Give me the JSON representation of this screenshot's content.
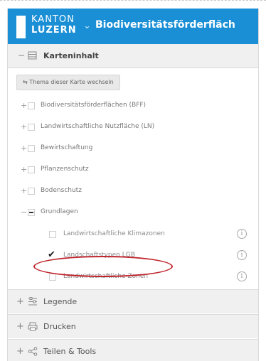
{
  "header": {
    "logo_line1": "KANTON",
    "logo_line2": "LUZERN",
    "chevron": "⌄",
    "title": "Biodiversitätsförderfläch"
  },
  "karteninhalt": {
    "toggle": "−",
    "icon": "map-layers-icon",
    "label": "Karteninhalt",
    "switch_button": "⇆ Thema dieser Karte wechseln",
    "groups": [
      {
        "toggle": "+",
        "label": "Biodiversitätsförderflächen (BFF)",
        "checked": false
      },
      {
        "toggle": "+",
        "label": "Landwirtschaftliche Nutzfläche (LN)",
        "checked": false
      },
      {
        "toggle": "+",
        "label": "Bewirtschaftung",
        "checked": false
      },
      {
        "toggle": "+",
        "label": "Pflanzenschutz",
        "checked": false
      },
      {
        "toggle": "+",
        "label": "Bodenschutz",
        "checked": false
      },
      {
        "toggle": "−",
        "label": "Grundlagen",
        "checked": "partial"
      }
    ],
    "sublayers": [
      {
        "label": "Landwirtschaftliche Klimazonen",
        "checked": false,
        "info": "i"
      },
      {
        "label": "Landschaftstypen LGB",
        "checked": true,
        "info": "i"
      },
      {
        "label": "Landwirtschaftliche Zonen",
        "checked": false,
        "info": "i"
      }
    ]
  },
  "legende": {
    "toggle": "+",
    "icon": "legend-list-icon",
    "label": "Legende"
  },
  "drucken": {
    "toggle": "+",
    "icon": "printer-icon",
    "label": "Drucken"
  },
  "teilen": {
    "toggle": "+",
    "icon": "share-icon",
    "label": "Teilen & Tools"
  },
  "colors": {
    "header_bg": "#1a8fd6",
    "section_bg": "#f0f0f0",
    "highlight": "#c0262d"
  }
}
